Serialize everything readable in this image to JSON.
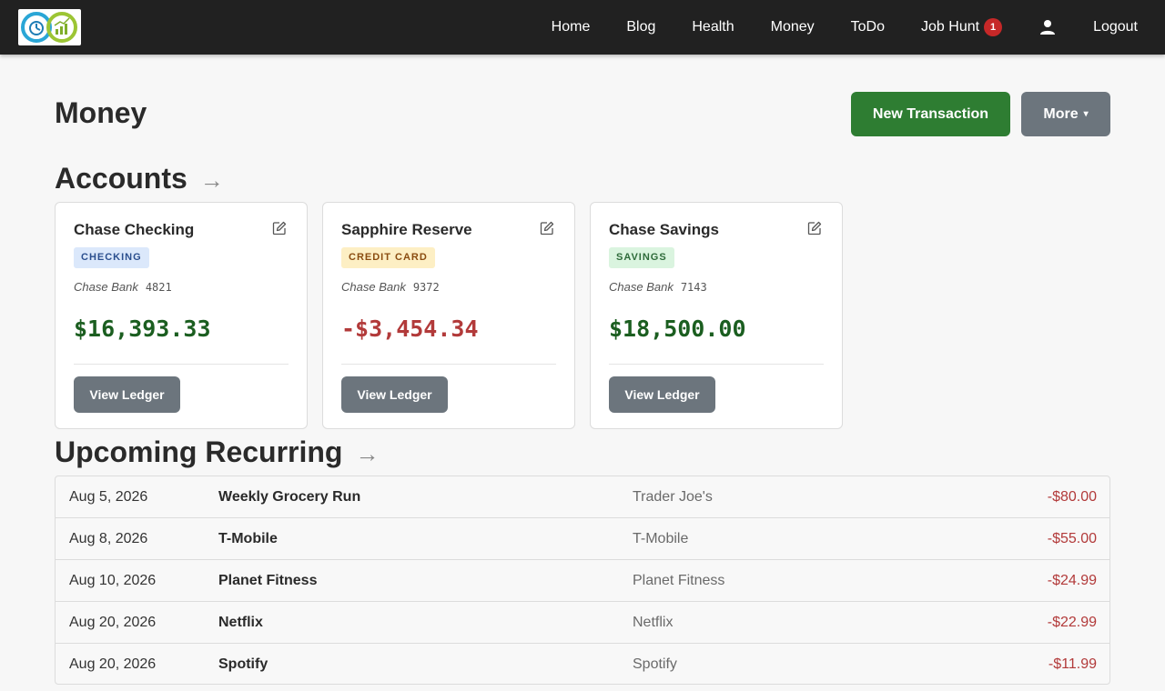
{
  "nav": {
    "links": [
      "Home",
      "Blog",
      "Health",
      "Money",
      "ToDo"
    ],
    "job_hunt": {
      "label": "Job Hunt",
      "badge": "1"
    },
    "logout": "Logout"
  },
  "page": {
    "title": "Money",
    "new_transaction": "New Transaction",
    "more": "More",
    "more_caret": "▾"
  },
  "accounts": {
    "title": "Accounts",
    "arrow": "→",
    "items": [
      {
        "name": "Chase Checking",
        "type": "CHECKING",
        "bank": "Chase Bank",
        "number": "4821",
        "balance": "$16,393.33",
        "ledger": "View Ledger"
      },
      {
        "name": "Sapphire Reserve",
        "type": "CREDIT CARD",
        "bank": "Chase Bank",
        "number": "9372",
        "balance": "-$3,454.34",
        "ledger": "View Ledger"
      },
      {
        "name": "Chase Savings",
        "type": "SAVINGS",
        "bank": "Chase Bank",
        "number": "7143",
        "balance": "$18,500.00",
        "ledger": "View Ledger"
      }
    ]
  },
  "recurring": {
    "title": "Upcoming Recurring",
    "arrow": "→",
    "rows": [
      {
        "date": "Aug 5, 2026",
        "name": "Weekly Grocery Run",
        "payee": "Trader Joe's",
        "amount": "-$80.00"
      },
      {
        "date": "Aug 8, 2026",
        "name": "T-Mobile",
        "payee": "T-Mobile",
        "amount": "-$55.00"
      },
      {
        "date": "Aug 10, 2026",
        "name": "Planet Fitness",
        "payee": "Planet Fitness",
        "amount": "-$24.99"
      },
      {
        "date": "Aug 20, 2026",
        "name": "Netflix",
        "payee": "Netflix",
        "amount": "-$22.99"
      },
      {
        "date": "Aug 20, 2026",
        "name": "Spotify",
        "payee": "Spotify",
        "amount": "-$11.99"
      }
    ]
  },
  "colors": {
    "navbar": "#212121",
    "primary_green": "#2e7d32",
    "secondary_gray": "#6c757d",
    "positive": "#1b5e20",
    "negative": "#b23a3a",
    "badge_red": "#c62828"
  },
  "icons": [
    "logo-icon",
    "user-icon",
    "edit-icon",
    "arrow-right-icon",
    "chevron-down-icon"
  ]
}
